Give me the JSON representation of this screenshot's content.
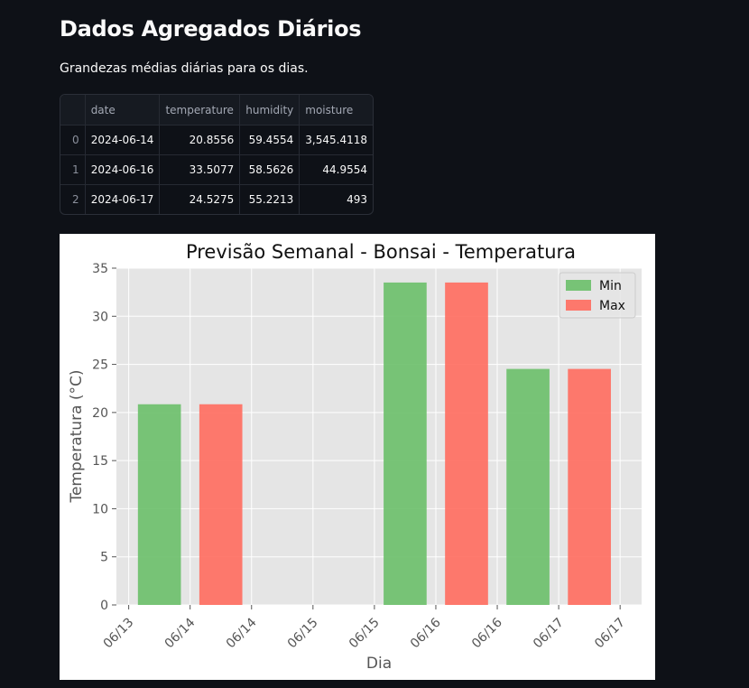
{
  "page": {
    "title": "Dados Agregados Diários",
    "subtitle": "Grandezas médias diárias para os dias."
  },
  "table": {
    "columns": [
      "",
      "date",
      "temperature",
      "humidity",
      "moisture"
    ],
    "rows": [
      {
        "index": "0",
        "date": "2024-06-14",
        "temperature": "20.8556",
        "humidity": "59.4554",
        "moisture": "3,545.4118"
      },
      {
        "index": "1",
        "date": "2024-06-16",
        "temperature": "33.5077",
        "humidity": "58.5626",
        "moisture": "44.9554"
      },
      {
        "index": "2",
        "date": "2024-06-17",
        "temperature": "24.5275",
        "humidity": "55.2213",
        "moisture": "493"
      }
    ]
  },
  "chart_data": {
    "type": "bar",
    "title": "Previsão Semanal - Bonsai  - Temperatura",
    "xlabel": "Dia",
    "ylabel": "Temperatura (°C)",
    "ylim": [
      0,
      35
    ],
    "yticks": [
      0,
      5,
      10,
      15,
      20,
      25,
      30,
      35
    ],
    "xlim": [
      -0.2,
      8.35
    ],
    "xtick_positions": [
      0,
      1,
      2,
      3,
      4,
      5,
      6,
      7,
      8
    ],
    "xtick_labels": [
      "06/13",
      "06/14",
      "06/14",
      "06/15",
      "06/15",
      "06/16",
      "06/16",
      "06/17",
      "06/17"
    ],
    "grid": true,
    "legend_position": "top-right",
    "bar_width": 0.7,
    "series": [
      {
        "name": "Min",
        "color": "#6abf69",
        "x": [
          0.5,
          4.5,
          6.5
        ],
        "values": [
          20.8556,
          33.5077,
          24.5275
        ]
      },
      {
        "name": "Max",
        "color": "#ff6b5e",
        "x": [
          1.5,
          5.5,
          7.5
        ],
        "values": [
          20.8556,
          33.5077,
          24.5275
        ]
      }
    ]
  }
}
